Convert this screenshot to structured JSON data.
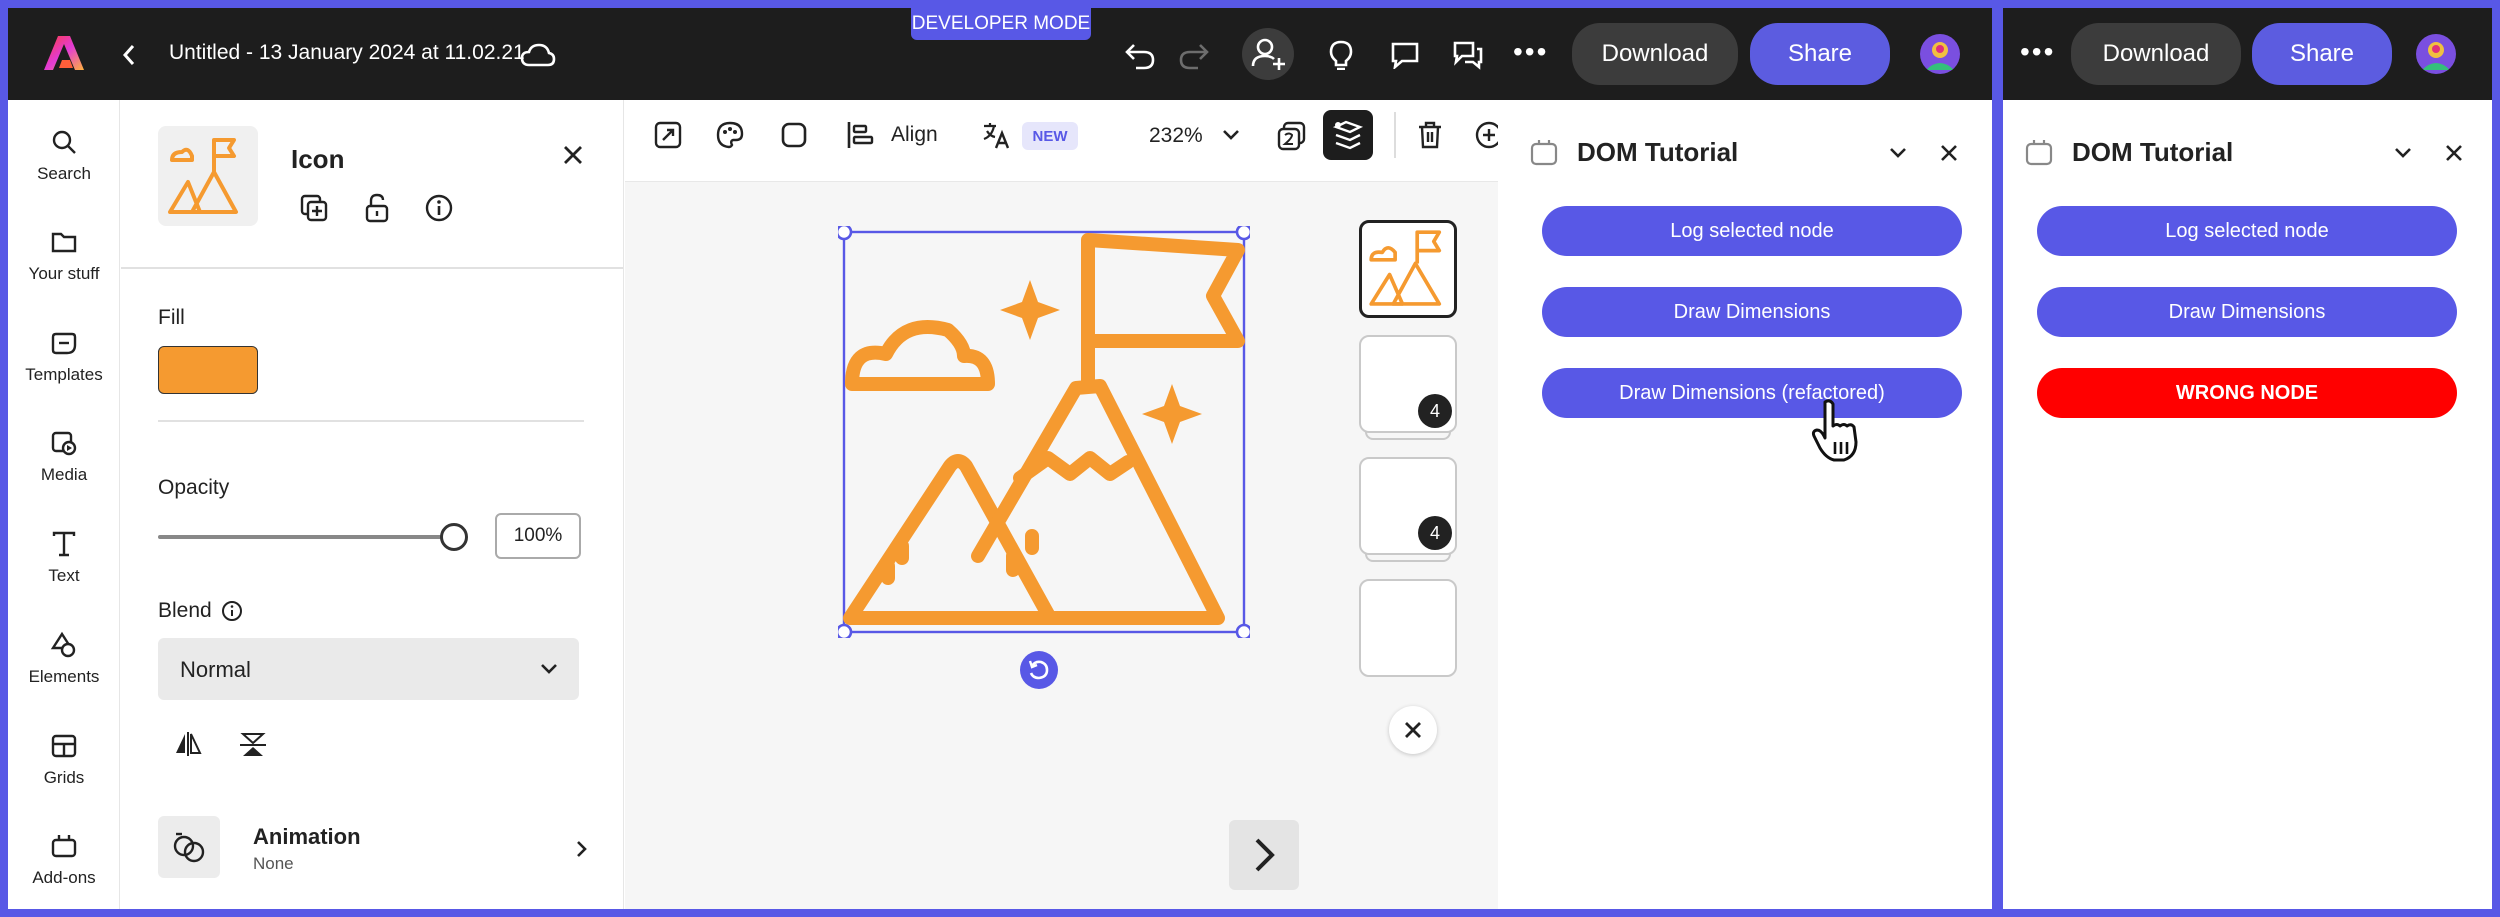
{
  "app": {
    "document_title": "Untitled - 13 January 2024 at 11.02.21",
    "developer_mode_label": "DEVELOPER MODE",
    "download_label": "Download",
    "share_label": "Share"
  },
  "rail": {
    "items": [
      {
        "label": "Search",
        "icon": "search-icon"
      },
      {
        "label": "Your stuff",
        "icon": "folder-icon"
      },
      {
        "label": "Templates",
        "icon": "templates-icon"
      },
      {
        "label": "Media",
        "icon": "media-icon"
      },
      {
        "label": "Text",
        "icon": "text-icon"
      },
      {
        "label": "Elements",
        "icon": "elements-icon"
      },
      {
        "label": "Grids",
        "icon": "grid-icon"
      },
      {
        "label": "Add-ons",
        "icon": "addons-icon"
      }
    ]
  },
  "properties": {
    "title": "Icon",
    "fill_label": "Fill",
    "fill_color": "#f59a30",
    "opacity_label": "Opacity",
    "opacity_value": "100%",
    "opacity_fraction": 1.0,
    "blend_label": "Blend",
    "blend_value": "Normal",
    "animation_label": "Animation",
    "animation_value": "None"
  },
  "toolbar": {
    "align_label": "Align",
    "new_badge": "NEW",
    "zoom_label": "232%"
  },
  "pages": {
    "badges": [
      "4",
      "4"
    ]
  },
  "plugin_left": {
    "title": "DOM Tutorial",
    "buttons": [
      "Log selected node",
      "Draw Dimensions",
      "Draw Dimensions (refactored)"
    ]
  },
  "plugin_right": {
    "title": "DOM Tutorial",
    "buttons": [
      "Log selected node",
      "Draw Dimensions",
      "WRONG NODE"
    ]
  },
  "colors": {
    "accent": "#5858e6",
    "icon_orange": "#f59a30",
    "error_red": "#ff0000",
    "topbar": "#1d1d1d"
  }
}
